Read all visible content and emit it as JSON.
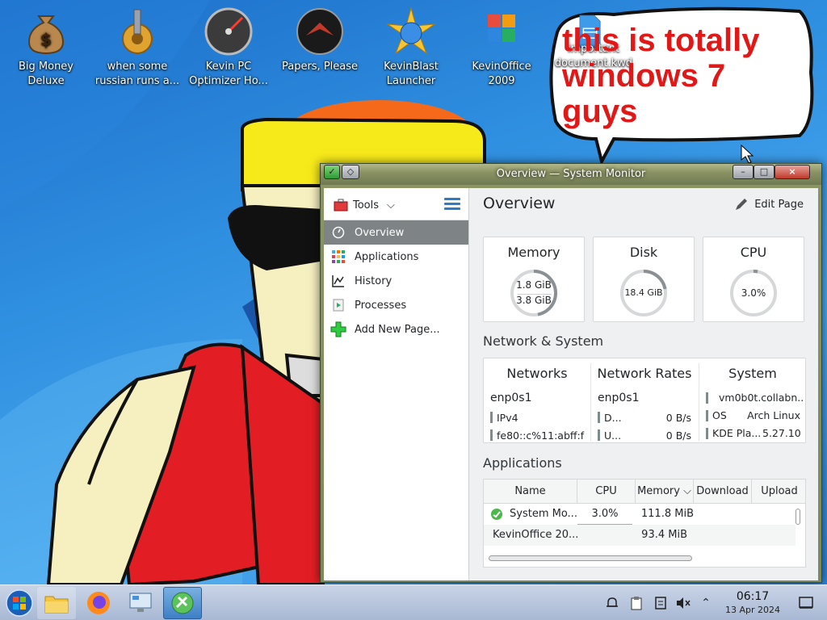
{
  "desktop": {
    "icons": [
      {
        "label": "Big Money\nDeluxe",
        "icon": "money-bag-icon"
      },
      {
        "label": "when some\nrussian runs a...",
        "icon": "gear-bolt-icon"
      },
      {
        "label": "Kevin PC\nOptimizer Ho...",
        "icon": "speedometer-icon"
      },
      {
        "label": "Papers, Please",
        "icon": "papers-please-seal-icon"
      },
      {
        "label": "KevinBlast\nLauncher",
        "icon": "cd-star-icon"
      },
      {
        "label": "KevinOffice\n2009",
        "icon": "office-squares-icon"
      },
      {
        "label": "important\ndocument.kwd",
        "icon": "document-icon"
      }
    ],
    "bubble_text": "this is totally windows 7 guys"
  },
  "window": {
    "title": "Overview — System Monitor",
    "buttons": {
      "minimize": "–",
      "maximize": "□",
      "close": "×"
    },
    "sidebar": {
      "tools_label": "Tools",
      "items": [
        {
          "label": "Overview",
          "active": true,
          "icon": "overview-icon"
        },
        {
          "label": "Applications",
          "active": false,
          "icon": "applications-grid-icon"
        },
        {
          "label": "History",
          "active": false,
          "icon": "history-graph-icon"
        },
        {
          "label": "Processes",
          "active": false,
          "icon": "processes-icon"
        },
        {
          "label": "Add New Page...",
          "active": false,
          "icon": "plus-icon"
        }
      ]
    },
    "main": {
      "title": "Overview",
      "edit_page_label": "Edit Page",
      "cards": {
        "memory": {
          "title": "Memory",
          "used": "1.8 GiB",
          "total": "3.8 GiB",
          "fraction": 0.47
        },
        "disk": {
          "title": "Disk",
          "value": "18.4 GiB",
          "fraction": 0.22
        },
        "cpu": {
          "title": "CPU",
          "value": "3.0%",
          "fraction": 0.03
        }
      },
      "network_system": {
        "section_title": "Network & System",
        "networks": {
          "title": "Networks",
          "iface": "enp0s1",
          "rows": [
            "IPv4",
            "fe80::c%11:abff:f"
          ]
        },
        "network_rates": {
          "title": "Network Rates",
          "iface": "enp0s1",
          "rows": [
            {
              "label": "D...",
              "value": "0 B/s"
            },
            {
              "label": "U...",
              "value": "0 B/s"
            }
          ]
        },
        "system": {
          "title": "System",
          "hostname": "vm0b0t.collabn..",
          "rows": [
            {
              "label": "OS",
              "value": "Arch Linux"
            },
            {
              "label": "KDE Pla...",
              "value": "5.27.10"
            }
          ]
        }
      },
      "applications": {
        "section_title": "Applications",
        "columns": [
          "Name",
          "CPU",
          "Memory",
          "Download",
          "Upload"
        ],
        "rows": [
          {
            "name": "System Mo...",
            "cpu": "3.0%",
            "memory": "111.8 MiB",
            "download": "",
            "upload": ""
          },
          {
            "name": "KevinOffice 20...",
            "cpu": "",
            "memory": "93.4 MiB",
            "download": "",
            "upload": ""
          }
        ]
      }
    }
  },
  "taskbar": {
    "apps": [
      "start-orb-icon",
      "file-manager-icon",
      "firefox-icon",
      "control-panel-icon",
      "system-monitor-icon"
    ],
    "time": "06:17",
    "date": "13 Apr 2024"
  },
  "colors": {
    "accent": "#2c7ac9",
    "sidebar_active": "#7e8385",
    "bubble_text": "#e01818",
    "window_frame": "#7b8a5c"
  }
}
